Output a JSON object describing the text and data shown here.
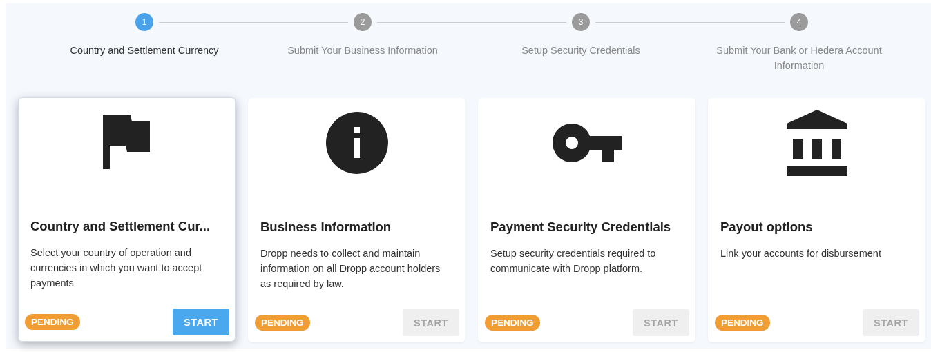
{
  "steps": [
    {
      "number": "1",
      "label": "Country and Settlement Currency",
      "selected": true
    },
    {
      "number": "2",
      "label": "Submit Your Business Information",
      "selected": false
    },
    {
      "number": "3",
      "label": "Setup Security Credentials",
      "selected": false
    },
    {
      "number": "4",
      "label": "Submit Your Bank or Hedera Account Information",
      "selected": false
    }
  ],
  "cards": [
    {
      "kind": "flag",
      "title": "Country and Settlement Cur...",
      "description": "Select your country of operation and currencies in which you want to accept payments",
      "status": "PENDING",
      "button": "START",
      "disabled": false,
      "selected": true
    },
    {
      "kind": "info",
      "title": "Business Information",
      "description": "Dropp needs to collect and maintain information on all Dropp account holders as required by law.",
      "status": "PENDING",
      "button": "START",
      "disabled": true,
      "selected": false
    },
    {
      "kind": "key",
      "title": "Payment Security Credentials",
      "description": "Setup security credentials required to communicate with Dropp platform.",
      "status": "PENDING",
      "button": "START",
      "disabled": true,
      "selected": false
    },
    {
      "kind": "bank",
      "title": "Payout options",
      "description": "Link your accounts for disbursement",
      "status": "PENDING",
      "button": "START",
      "disabled": true,
      "selected": false
    }
  ]
}
